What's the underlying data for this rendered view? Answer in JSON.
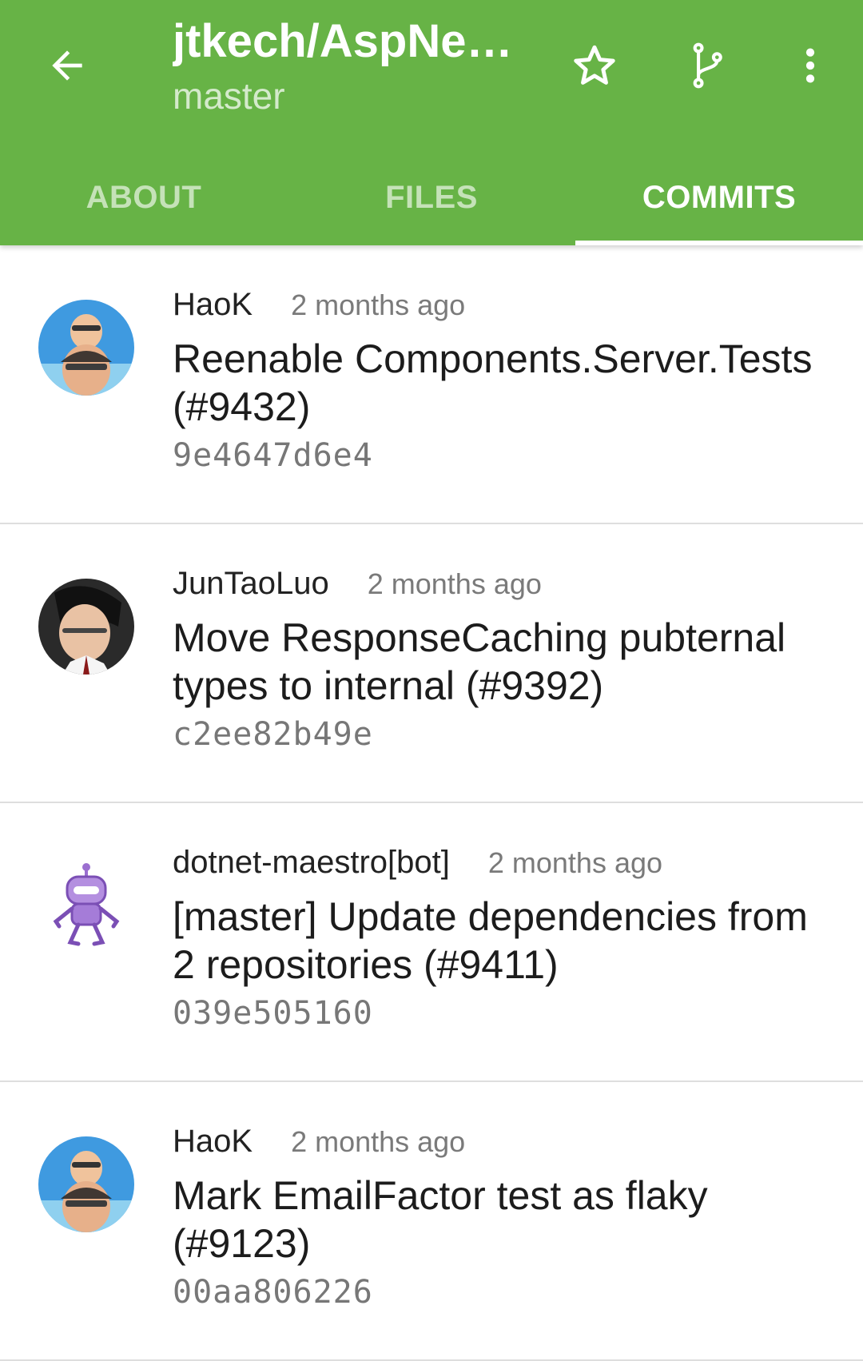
{
  "header": {
    "title": "jtkech/AspNet…",
    "subtitle": "master",
    "back_icon": "arrow-left-icon",
    "actions": [
      "star-icon",
      "branch-icon",
      "more-vertical-icon"
    ],
    "color": "#67b346"
  },
  "tabs": [
    {
      "label": "ABOUT",
      "active": false
    },
    {
      "label": "FILES",
      "active": false
    },
    {
      "label": "COMMITS",
      "active": true
    }
  ],
  "commits": [
    {
      "author": "HaoK",
      "time": "2 months ago",
      "message": "Reenable Components.Server.Tests (#9432)",
      "sha": "9e4647d6e4",
      "avatar": "person-avatar"
    },
    {
      "author": "JunTaoLuo",
      "time": "2 months ago",
      "message": "Move ResponseCaching pubternal types to internal (#9392)",
      "sha": "c2ee82b49e",
      "avatar": "person-avatar"
    },
    {
      "author": "dotnet-maestro[bot]",
      "time": "2 months ago",
      "message": "[master] Update dependencies from  2 repositories (#9411)",
      "sha": "039e505160",
      "avatar": "robot-avatar"
    },
    {
      "author": "HaoK",
      "time": "2 months ago",
      "message": "Mark EmailFactor test as flaky (#9123)",
      "sha": "00aa806226",
      "avatar": "person-avatar"
    }
  ]
}
